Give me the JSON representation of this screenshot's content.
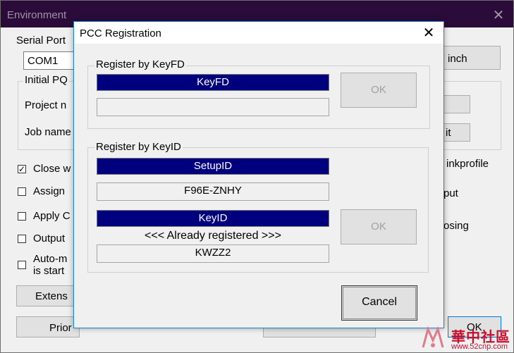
{
  "environment": {
    "title": "Environment",
    "close_glyph": "✕",
    "serial_port_label": "Serial Port",
    "serial_port_value": "COM1",
    "unit_label": "' inch",
    "initial_pq_label": "Initial PQ",
    "project_label": "Project n",
    "job_name_label": "Job name",
    "it_button": "it",
    "close_label": "Close w",
    "close_checked": true,
    "inkprofile_label": "inkprofile",
    "assign_label": "Assign",
    "put_label": "put",
    "apply_label": "Apply C",
    "osing_label": "osing",
    "output_label": "Output",
    "automatic_label_1": "Auto-m",
    "automatic_label_2": "is start",
    "extens_button": "Extens",
    "prior_button": "Prior",
    "ok_button": "OK"
  },
  "pcc": {
    "title": "PCC Registration",
    "close_glyph": "✕",
    "keyfd_group": {
      "label": "Register by KeyFD",
      "header": "KeyFD",
      "value": "",
      "ok": "OK"
    },
    "keyid_group": {
      "label": "Register by KeyID",
      "setup_header": "SetupID",
      "setup_value": "F96E-ZNHY",
      "key_header": "KeyID",
      "status": "<<< Already registered >>>",
      "key_value": "KWZZ2",
      "ok": "OK"
    },
    "cancel": "Cancel"
  },
  "watermark": {
    "title": "華中社區",
    "url": "www.52cnp.com"
  }
}
